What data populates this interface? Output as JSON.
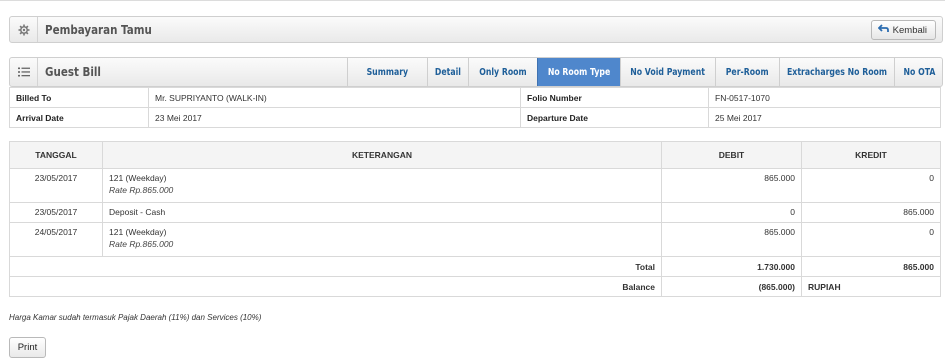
{
  "header": {
    "title": "Pembayaran Tamu",
    "icon": "gear-icon",
    "back_label": "Kembali",
    "back_icon": "return-arrow-icon"
  },
  "guest_bill": {
    "title": "Guest Bill",
    "icon": "list-icon",
    "tabs": [
      {
        "label": "Summary",
        "active": false
      },
      {
        "label": "Detail",
        "active": false
      },
      {
        "label": "Only Room",
        "active": false
      },
      {
        "label": "No Room Type",
        "active": true
      },
      {
        "label": "No Void Payment",
        "active": false
      },
      {
        "label": "Per-Room",
        "active": false
      },
      {
        "label": "Extracharges No Room",
        "active": false
      },
      {
        "label": "No OTA",
        "active": false
      }
    ]
  },
  "info": {
    "billed_to_label": "Billed To",
    "billed_to_value": "Mr. SUPRIYANTO (WALK-IN)",
    "folio_label": "Folio Number",
    "folio_value": "FN-0517-1070",
    "arrival_label": "Arrival Date",
    "arrival_value": "23 Mei 2017",
    "departure_label": "Departure Date",
    "departure_value": "25 Mei 2017"
  },
  "bill": {
    "columns": {
      "tanggal": "TANGGAL",
      "keterangan": "KETERANGAN",
      "debit": "DEBIT",
      "kredit": "KREDIT"
    },
    "rows": [
      {
        "tanggal": "23/05/2017",
        "keterangan": "121 (Weekday)",
        "rate": "Rate Rp.865.000",
        "debit": "865.000",
        "kredit": "0"
      },
      {
        "tanggal": "23/05/2017",
        "keterangan": "Deposit - Cash",
        "rate": "",
        "debit": "0",
        "kredit": "865.000"
      },
      {
        "tanggal": "24/05/2017",
        "keterangan": "121 (Weekday)",
        "rate": "Rate Rp.865.000",
        "debit": "865.000",
        "kredit": "0"
      }
    ],
    "total_label": "Total",
    "total_debit": "1.730.000",
    "total_kredit": "865.000",
    "balance_label": "Balance",
    "balance_value": "(865.000)",
    "balance_currency": "RUPIAH"
  },
  "note": "Harga Kamar sudah termasuk Pajak Daerah (11%) dan Services (10%)",
  "print_label": "Print",
  "colors": {
    "active_tab": "#4f87cc",
    "tab_text": "#1f5f99"
  }
}
